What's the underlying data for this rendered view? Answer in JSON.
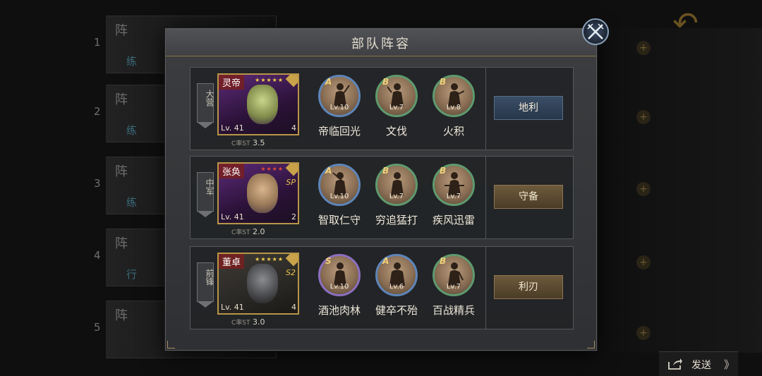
{
  "modal": {
    "title": "部队阵容"
  },
  "rows": [
    {
      "position": "大营",
      "general": {
        "name": "灵帝",
        "stars": "★★★★★",
        "level": "Lv. 41",
        "troop": "4",
        "sp": "",
        "cost_label": "C率ST",
        "cost": "3.5"
      },
      "skills": [
        {
          "grade": "A",
          "level": "Lv.10",
          "name": "帝临回光"
        },
        {
          "grade": "B",
          "level": "Lv.7",
          "name": "文伐"
        },
        {
          "grade": "B",
          "level": "Lv.8",
          "name": "火积"
        }
      ],
      "terrain": "地利"
    },
    {
      "position": "中军",
      "general": {
        "name": "张奂",
        "stars": "★★★★",
        "level": "Lv. 41",
        "troop": "2",
        "sp": "SP",
        "cost_label": "C率ST",
        "cost": "2.0"
      },
      "skills": [
        {
          "grade": "A",
          "level": "Lv.10",
          "name": "智取仁守"
        },
        {
          "grade": "B",
          "level": "Lv.7",
          "name": "穷追猛打"
        },
        {
          "grade": "B",
          "level": "Lv.7",
          "name": "疾风迅雷"
        }
      ],
      "terrain": "守备"
    },
    {
      "position": "前锋",
      "general": {
        "name": "董卓",
        "stars": "★★★★★",
        "level": "Lv. 41",
        "troop": "4",
        "sp": "S2",
        "cost_label": "C率ST",
        "cost": "3.0"
      },
      "skills": [
        {
          "grade": "S",
          "level": "Lv.10",
          "name": "酒池肉林"
        },
        {
          "grade": "A",
          "level": "Lv.6",
          "name": "健卒不殆"
        },
        {
          "grade": "B",
          "level": "Lv.7",
          "name": "百战精兵"
        }
      ],
      "terrain": "利刃"
    }
  ],
  "send_button": {
    "label": "发送",
    "arrow": "》"
  }
}
